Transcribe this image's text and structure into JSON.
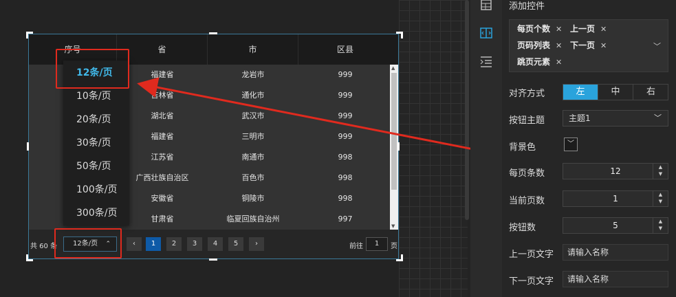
{
  "table": {
    "columns": [
      "序号",
      "省",
      "市",
      "区县"
    ],
    "rows": [
      {
        "prov": "福建省",
        "city": "龙岩市",
        "county": "999"
      },
      {
        "prov": "吉林省",
        "city": "通化市",
        "county": "999"
      },
      {
        "prov": "湖北省",
        "city": "武汉市",
        "county": "999"
      },
      {
        "prov": "福建省",
        "city": "三明市",
        "county": "999"
      },
      {
        "prov": "江苏省",
        "city": "南通市",
        "county": "998"
      },
      {
        "prov": "广西壮族自治区",
        "city": "百色市",
        "county": "998"
      },
      {
        "prov": "安徽省",
        "city": "铜陵市",
        "county": "998"
      },
      {
        "prov": "甘肃省",
        "city": "临夏回族自治州",
        "county": "997"
      }
    ]
  },
  "pager": {
    "total": "共 60 条",
    "size": "12条/页",
    "pages": [
      "1",
      "2",
      "3",
      "4",
      "5"
    ],
    "current": "1",
    "prev": "‹",
    "next": "›",
    "goto_label": "前往",
    "goto_value": "1",
    "page_suffix": "页"
  },
  "dropdown": {
    "options": [
      "12条/页",
      "10条/页",
      "20条/页",
      "30条/页",
      "50条/页",
      "100条/页",
      "300条/页"
    ]
  },
  "props": {
    "add_controls_label": "添加控件",
    "chips": [
      "每页个数",
      "上一页",
      "页码列表",
      "下一页",
      "跳页元素"
    ],
    "align_label": "对齐方式",
    "align_options": [
      "左",
      "中",
      "右"
    ],
    "theme_label": "按钮主题",
    "theme_value": "主题1",
    "bg_label": "背景色",
    "page_size_label": "每页条数",
    "page_size_value": "12",
    "current_page_label": "当前页数",
    "current_page_value": "1",
    "btn_count_label": "按钮数",
    "btn_count_value": "5",
    "prev_text_label": "上一页文字",
    "prev_text_placeholder": "请输入名称",
    "next_text_label": "下一页文字",
    "next_text_placeholder": "请输入名称"
  },
  "colors": {
    "accent": "#2aa3dc",
    "highlight": "#e02a1e",
    "selected_option": "#41b9ea",
    "active_page": "#0e5aa7"
  },
  "icons": [
    "table-icon",
    "pagination-icon",
    "list-indent-icon",
    "chevron-down-icon",
    "close-icon"
  ]
}
